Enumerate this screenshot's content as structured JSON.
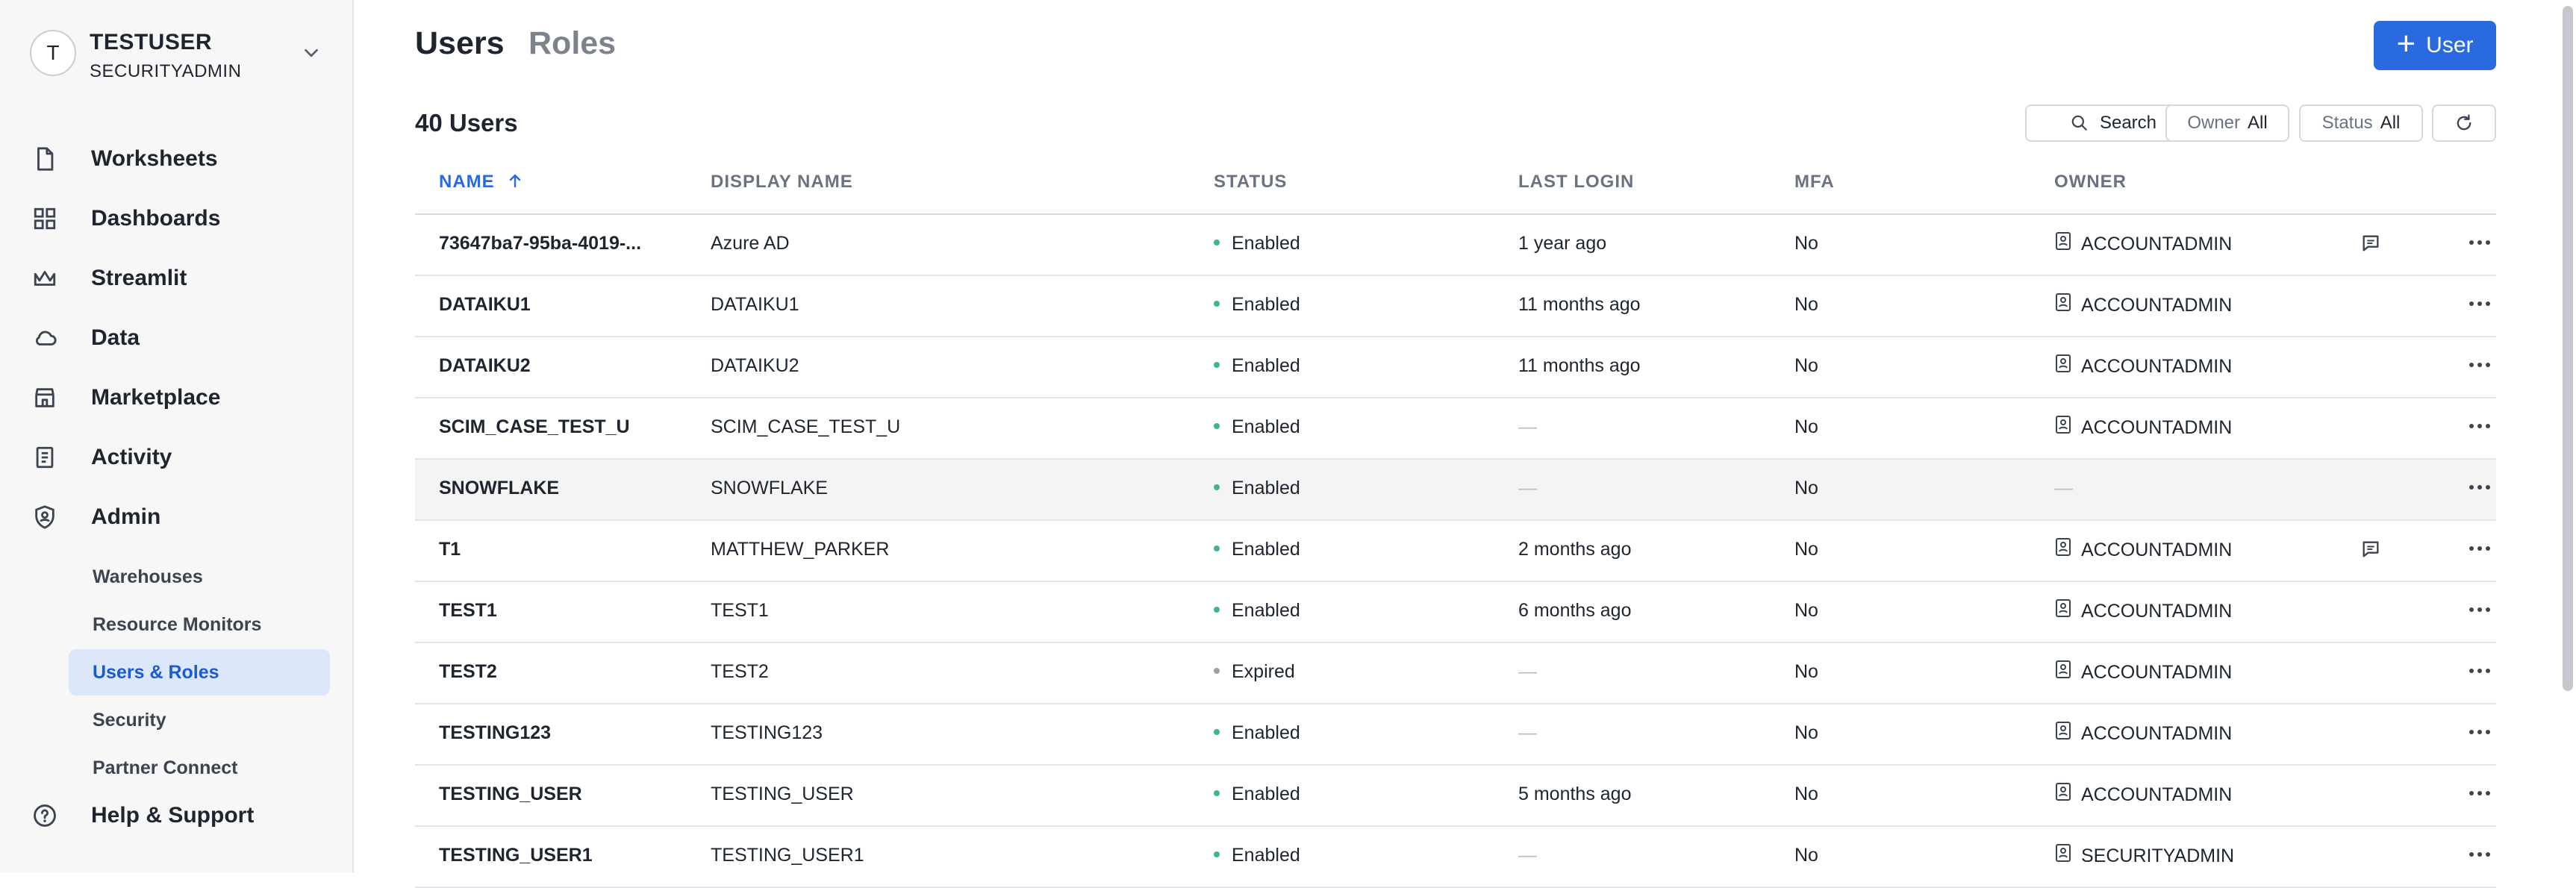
{
  "sidebar": {
    "avatar_initial": "T",
    "user_name": "TESTUSER",
    "user_role": "SECURITYADMIN",
    "nav": [
      {
        "label": "Worksheets",
        "icon": "document-icon"
      },
      {
        "label": "Dashboards",
        "icon": "grid-icon"
      },
      {
        "label": "Streamlit",
        "icon": "crown-icon"
      },
      {
        "label": "Data",
        "icon": "cloud-icon"
      },
      {
        "label": "Marketplace",
        "icon": "store-icon"
      },
      {
        "label": "Activity",
        "icon": "list-doc-icon"
      },
      {
        "label": "Admin",
        "icon": "shield-icon"
      }
    ],
    "admin_sub": [
      "Warehouses",
      "Resource Monitors",
      "Users & Roles",
      "Security",
      "Partner Connect"
    ],
    "active_sub": "Users & Roles",
    "help": {
      "label": "Help & Support",
      "icon": "help-icon"
    }
  },
  "header": {
    "tabs": [
      "Users",
      "Roles"
    ],
    "active_tab": "Users",
    "add_button_label": "User"
  },
  "toolbar": {
    "count_label": "40 Users",
    "search_label": "Search",
    "owner_label": "Owner",
    "owner_value": "All",
    "status_label": "Status",
    "status_value": "All"
  },
  "table": {
    "columns": [
      "NAME",
      "DISPLAY NAME",
      "STATUS",
      "LAST LOGIN",
      "MFA",
      "OWNER"
    ],
    "sorted_column": "NAME",
    "sort_direction": "ascending",
    "rows": [
      {
        "name": "73647ba7-95ba-4019-...",
        "display": "Azure AD",
        "status": "Enabled",
        "login": "1 year ago",
        "mfa": "No",
        "owner": "ACCOUNTADMIN",
        "comment": true
      },
      {
        "name": "DATAIKU1",
        "display": "DATAIKU1",
        "status": "Enabled",
        "login": "11 months ago",
        "mfa": "No",
        "owner": "ACCOUNTADMIN",
        "comment": false
      },
      {
        "name": "DATAIKU2",
        "display": "DATAIKU2",
        "status": "Enabled",
        "login": "11 months ago",
        "mfa": "No",
        "owner": "ACCOUNTADMIN",
        "comment": false
      },
      {
        "name": "SCIM_CASE_TEST_U",
        "display": "SCIM_CASE_TEST_U",
        "status": "Enabled",
        "login": "—",
        "mfa": "No",
        "owner": "ACCOUNTADMIN",
        "comment": false
      },
      {
        "name": "SNOWFLAKE",
        "display": "SNOWFLAKE",
        "status": "Enabled",
        "login": "—",
        "mfa": "No",
        "owner": "—",
        "comment": false
      },
      {
        "name": "T1",
        "display": "MATTHEW_PARKER",
        "status": "Enabled",
        "login": "2 months ago",
        "mfa": "No",
        "owner": "ACCOUNTADMIN",
        "comment": true
      },
      {
        "name": "TEST1",
        "display": "TEST1",
        "status": "Enabled",
        "login": "6 months ago",
        "mfa": "No",
        "owner": "ACCOUNTADMIN",
        "comment": false
      },
      {
        "name": "TEST2",
        "display": "TEST2",
        "status": "Expired",
        "login": "—",
        "mfa": "No",
        "owner": "ACCOUNTADMIN",
        "comment": false
      },
      {
        "name": "TESTING123",
        "display": "TESTING123",
        "status": "Enabled",
        "login": "—",
        "mfa": "No",
        "owner": "ACCOUNTADMIN",
        "comment": false
      },
      {
        "name": "TESTING_USER",
        "display": "TESTING_USER",
        "status": "Enabled",
        "login": "5 months ago",
        "mfa": "No",
        "owner": "ACCOUNTADMIN",
        "comment": false
      },
      {
        "name": "TESTING_USER1",
        "display": "TESTING_USER1",
        "status": "Enabled",
        "login": "—",
        "mfa": "No",
        "owner": "SECURITYADMIN",
        "comment": false
      }
    ]
  },
  "colors": {
    "accent": "#2a6ae0",
    "enabled_dot": "#3fb68b",
    "expired_dot": "#9aa0a6",
    "active_nav_bg": "#dde7fb"
  }
}
